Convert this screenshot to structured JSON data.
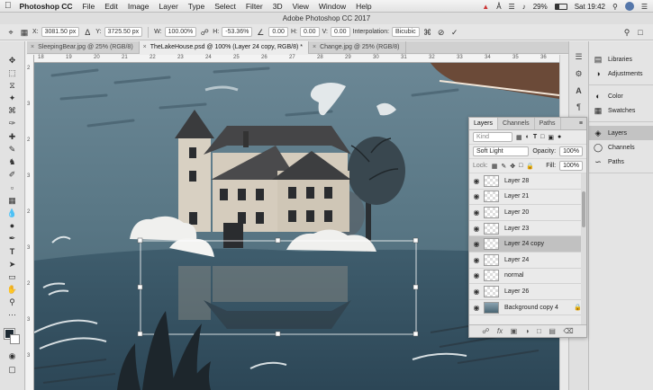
{
  "menubar": {
    "apple": "",
    "app_name": "Photoshop CC",
    "items": [
      "File",
      "Edit",
      "Image",
      "Layer",
      "Type",
      "Select",
      "Filter",
      "3D",
      "View",
      "Window",
      "Help"
    ],
    "battery": "29%",
    "clock": "Sat 19:42"
  },
  "window": {
    "title": "Adobe Photoshop CC 2017"
  },
  "options": {
    "x_label": "X:",
    "x_value": "3081.50 px",
    "y_label": "Y:",
    "y_value": "3725.50 px",
    "w_label": "W:",
    "w_value": "100.00%",
    "h_label": "H:",
    "h_value": "-53.36%",
    "angle_value": "0.00",
    "hskew_label": "H:",
    "hskew_value": "0.00",
    "vskew_label": "V:",
    "vskew_value": "0.00",
    "interp_label": "Interpolation:",
    "interp_value": "Bicubic"
  },
  "tabs": [
    {
      "label": "SleepingBear.jpg @ 25% (RGB/8)"
    },
    {
      "label": "TheLakeHouse.psd @ 100% (Layer 24 copy, RGB/8) *"
    },
    {
      "label": "Change.jpg @ 25% (RGB/8)"
    }
  ],
  "ruler_top": [
    "18",
    "19",
    "20",
    "21",
    "22",
    "23",
    "24",
    "25",
    "26",
    "27",
    "28",
    "29",
    "30",
    "31",
    "32",
    "33",
    "34",
    "35",
    "36"
  ],
  "ruler_left": [
    "2",
    "3",
    "2",
    "3",
    "2",
    "3",
    "2",
    "3",
    "3"
  ],
  "dock": {
    "items": [
      {
        "label": "Libraries"
      },
      {
        "label": "Adjustments"
      },
      {
        "label": "Color"
      },
      {
        "label": "Swatches"
      },
      {
        "label": "Layers"
      },
      {
        "label": "Channels"
      },
      {
        "label": "Paths"
      }
    ]
  },
  "layers_panel": {
    "tabs": [
      "Layers",
      "Channels",
      "Paths"
    ],
    "kind_placeholder": "Kind",
    "blend_mode": "Soft Light",
    "opacity_label": "Opacity:",
    "opacity_value": "100%",
    "lock_label": "Lock:",
    "fill_label": "Fill:",
    "fill_value": "100%",
    "layers": [
      {
        "name": "Layer 28",
        "locked": false
      },
      {
        "name": "Layer 21",
        "locked": false
      },
      {
        "name": "Layer 20",
        "locked": false
      },
      {
        "name": "Layer 23",
        "locked": false
      },
      {
        "name": "Layer 24 copy",
        "locked": false,
        "selected": true
      },
      {
        "name": "Layer 24",
        "locked": false
      },
      {
        "name": "normal",
        "locked": false
      },
      {
        "name": "Layer 26",
        "locked": false
      },
      {
        "name": "Background copy 4",
        "locked": true
      }
    ]
  }
}
